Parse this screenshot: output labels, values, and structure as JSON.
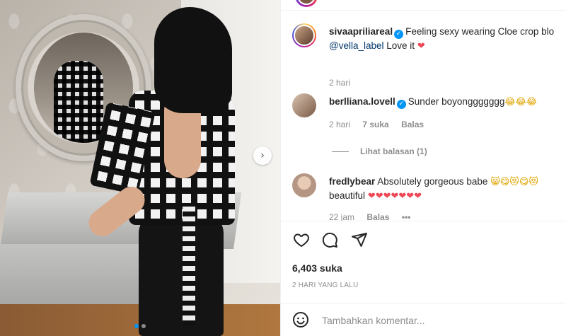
{
  "post": {
    "carousel": {
      "slide_count": 2,
      "active_index": 0
    },
    "caption": {
      "username": "sivaaprilia real",
      "username_display": "sivaapriliareal",
      "text": "Feeling sexy wearing Cloe crop blo",
      "mention": "@vella_label",
      "text2": "Love it",
      "time": "2 hari"
    },
    "comments": [
      {
        "username": "berlliana.lovell",
        "text": "Sunder boyonggggggg",
        "emoji": "😂😂😂",
        "time": "2 hari",
        "likes": "7 suka",
        "reply": "Balas",
        "view_replies": "Lihat balasan (1)"
      },
      {
        "username": "fredlybear",
        "text": "Absolutely gorgeous babe",
        "emoji": "😸😋😻😋😻",
        "line2": "beautiful",
        "hearts": "❤❤❤❤❤❤❤",
        "time": "22 jam",
        "reply": "Balas",
        "more": "•••"
      }
    ],
    "likes": "6,403 suka",
    "date": "2 HARI YANG LALU",
    "comment_placeholder": "Tambahkan komentar..."
  },
  "colors": {
    "accent": "#0095f6",
    "heart": "#ed4956",
    "muted": "#8e8e8e",
    "text": "#262626"
  }
}
